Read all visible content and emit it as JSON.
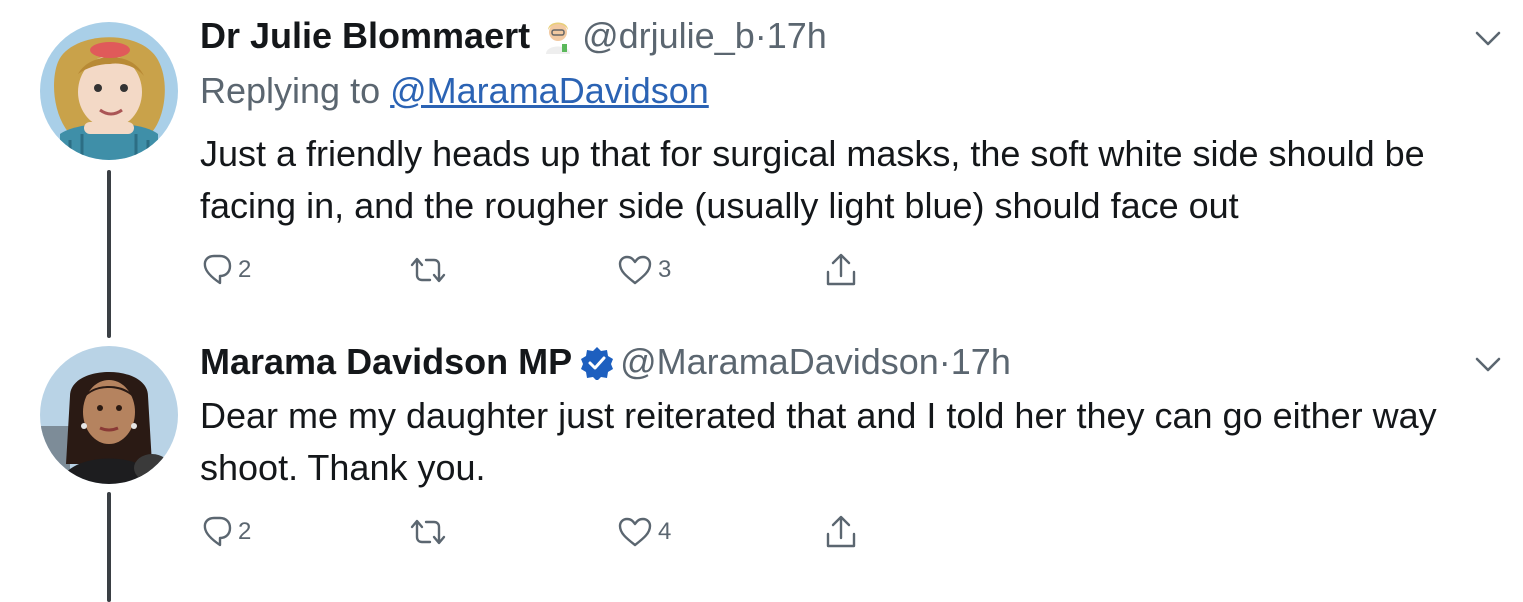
{
  "tweets": [
    {
      "display_name": "Dr Julie Blommaert",
      "name_emoji": "woman-scientist-emoji",
      "handle": "@drjulie_b",
      "separator": "·",
      "time": "17h",
      "replying_prefix": "Replying to",
      "replying_to": "@MaramaDavidson",
      "text": "Just a friendly heads up that for surgical masks, the soft white side should be facing in, and the rougher side (usually light blue) should face out",
      "replies": "2",
      "likes": "3",
      "verified": false
    },
    {
      "display_name": "Marama Davidson MP",
      "handle": "@MaramaDavidson",
      "separator": "·",
      "time": "17h",
      "text": "Dear me my daughter just reiterated that and I told her they can go either way shoot. Thank you.",
      "replies": "2",
      "likes": "4",
      "verified": true
    }
  ],
  "colors": {
    "text": "#14171a",
    "secondary": "#5b6670",
    "link": "#2b63b4",
    "verified": "#1d5fbf",
    "thread_line": "#3a3f44"
  },
  "icons": [
    "chevron-down-icon",
    "reply-icon",
    "retweet-icon",
    "like-icon",
    "share-icon",
    "verified-badge-icon"
  ]
}
